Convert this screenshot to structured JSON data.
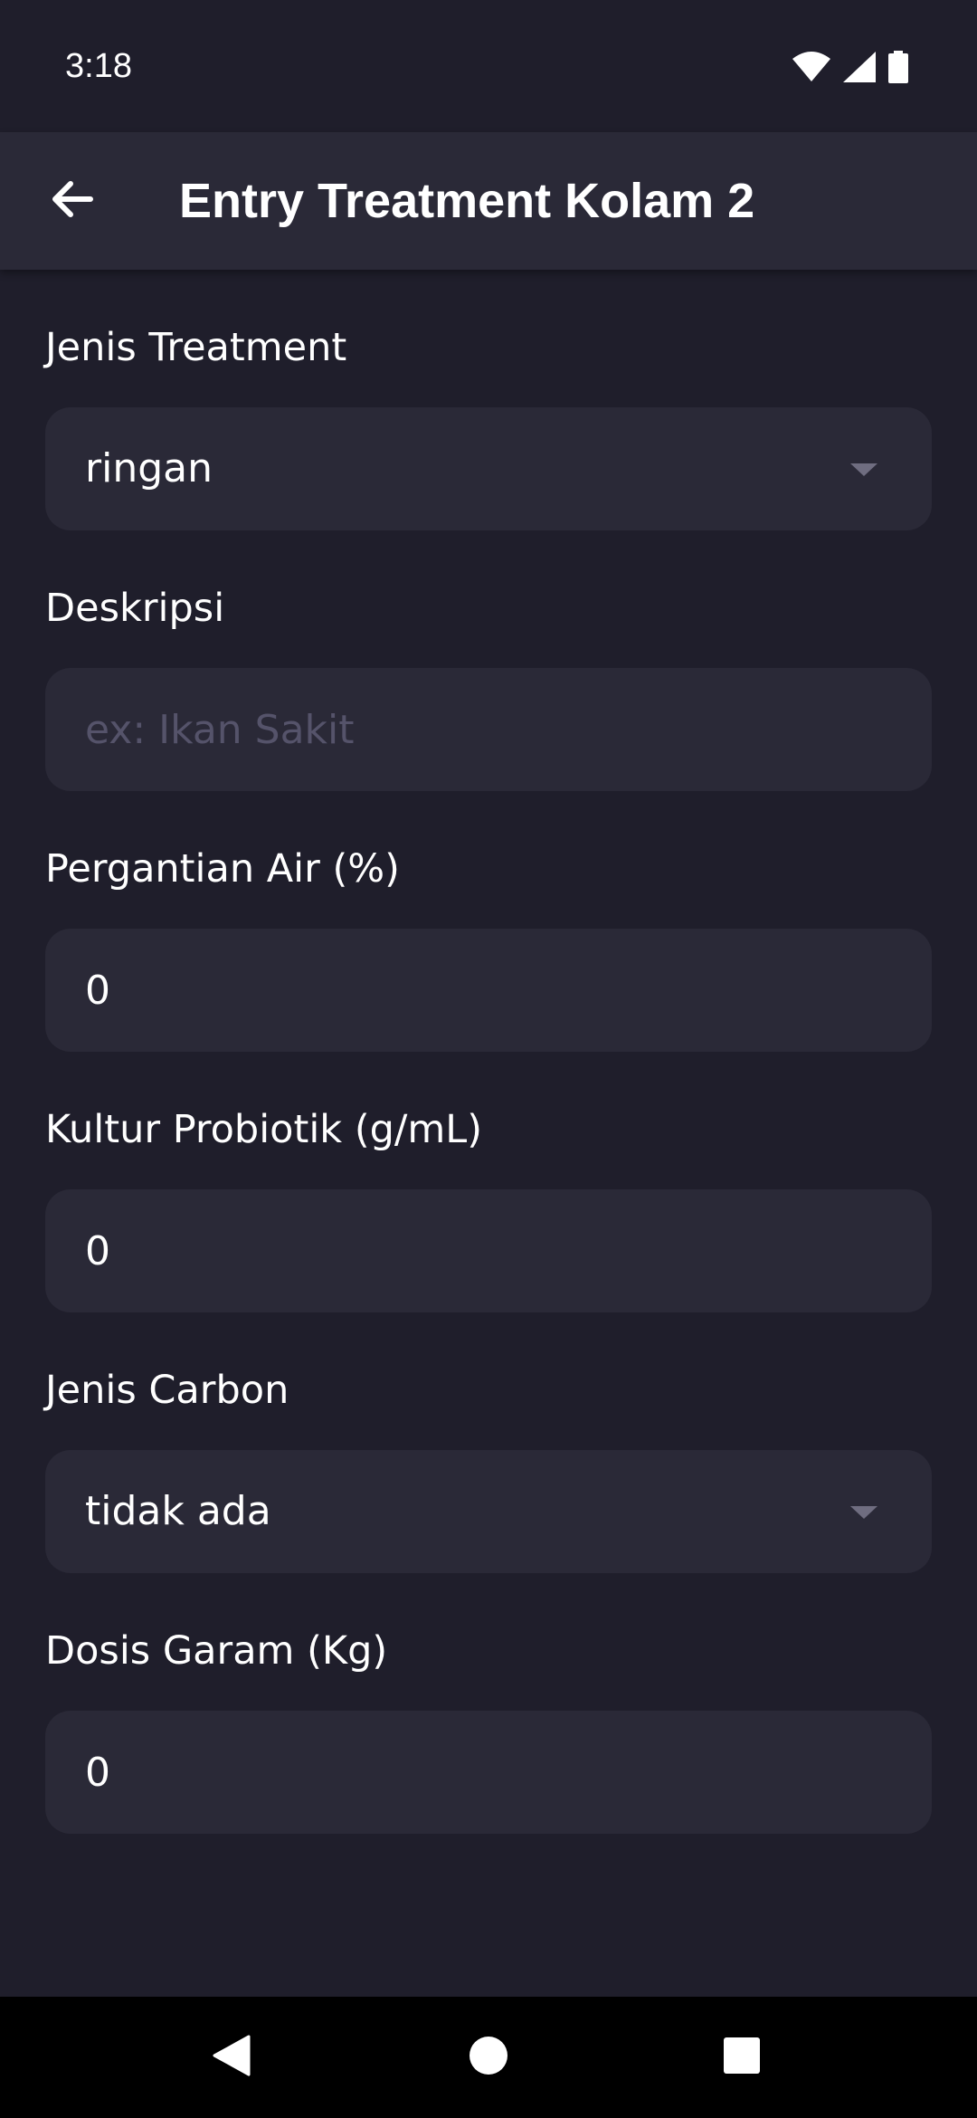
{
  "status_bar": {
    "time": "3:18",
    "icons": [
      "wifi-icon",
      "cellular-signal-icon",
      "battery-icon"
    ]
  },
  "app_bar": {
    "back_icon": "arrow-left-icon",
    "title": "Entry Treatment Kolam 2"
  },
  "form": {
    "jenis_treatment": {
      "label": "Jenis Treatment",
      "value": "ringan",
      "icon": "dropdown-arrow-icon"
    },
    "deskripsi": {
      "label": "Deskripsi",
      "value": "",
      "placeholder": "ex: Ikan Sakit"
    },
    "pergantian_air": {
      "label": "Pergantian Air (%)",
      "value": "0"
    },
    "kultur_probiotik": {
      "label": "Kultur Probiotik (g/mL)",
      "value": "0"
    },
    "jenis_carbon": {
      "label": "Jenis Carbon",
      "value": "tidak ada",
      "icon": "dropdown-arrow-icon"
    },
    "dosis_garam": {
      "label": "Dosis Garam (Kg)",
      "value": "0"
    }
  },
  "nav_bar": {
    "icons": [
      "nav-back-icon",
      "nav-home-icon",
      "nav-recents-icon"
    ]
  },
  "colors": {
    "background": "#1f1e2b",
    "surface": "#2a2937",
    "text": "#ffffff",
    "placeholder": "#55536a",
    "nav_background": "#000000"
  }
}
